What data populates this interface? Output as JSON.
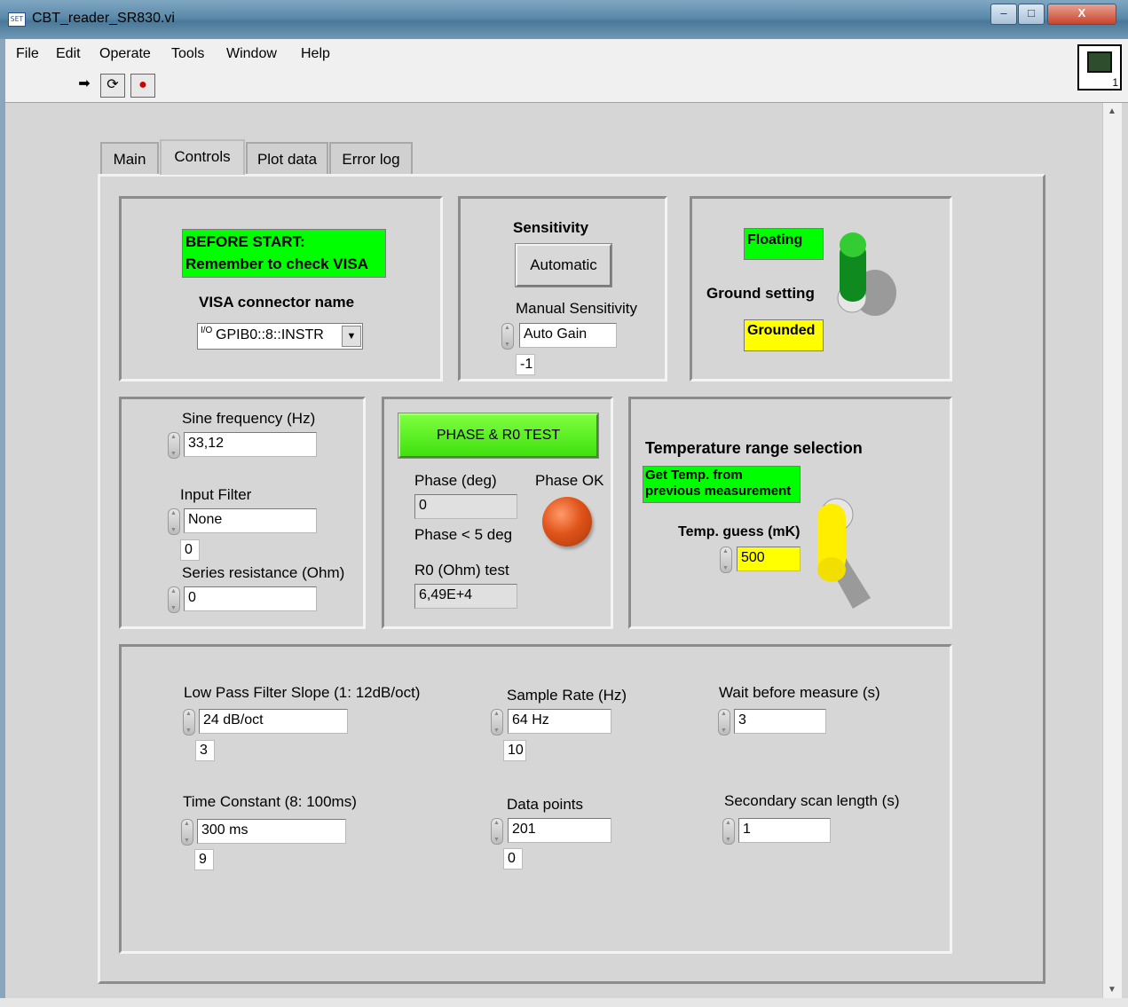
{
  "window": {
    "title": "CBT_reader_SR830.vi",
    "icon_text": "SET"
  },
  "window_buttons": {
    "min": "–",
    "max": "□",
    "close": "X"
  },
  "menu": [
    {
      "label": "File"
    },
    {
      "label": "Edit"
    },
    {
      "label": "Operate"
    },
    {
      "label": "Tools"
    },
    {
      "label": "Window"
    },
    {
      "label": "Help"
    }
  ],
  "toolbar": {
    "run": "➡",
    "run_continuously": "⟳",
    "abort": "●"
  },
  "vi_icon": {
    "number": "1"
  },
  "tabs": [
    {
      "label": "Main"
    },
    {
      "label": "Controls"
    },
    {
      "label": "Plot data"
    },
    {
      "label": "Error log"
    }
  ],
  "visa_box": {
    "warning": "BEFORE START:\nRemember to check VISA",
    "connector_label": "VISA connector name",
    "io_icon": "I/O",
    "connector_value": "GPIB0::8::INSTR",
    "dropdown_arrow": "▼"
  },
  "sensitivity_box": {
    "title": "Sensitivity",
    "auto_button": "Automatic",
    "manual_label": "Manual Sensitivity",
    "manual_value": "Auto Gain",
    "manual_index": "-1"
  },
  "ground_box": {
    "floating": "Floating",
    "label": "Ground setting",
    "grounded": "Grounded",
    "state": "Floating"
  },
  "signal_box": {
    "sine_label": "Sine frequency (Hz)",
    "sine_value": "33,12",
    "filter_label": "Input Filter",
    "filter_value": "None",
    "filter_index": "0",
    "series_label": "Series resistance (Ohm)",
    "series_value": "0"
  },
  "phase_box": {
    "test_button": "PHASE & R0 TEST",
    "phase_label": "Phase (deg)",
    "phase_value": "0",
    "phase_ok_label": "Phase OK",
    "phase_note": "Phase < 5 deg",
    "r0_label": "R0 (Ohm) test",
    "r0_value": "6,49E+4",
    "led_color": "#e0541a"
  },
  "temp_box": {
    "title": "Temperature range selection",
    "get_temp": "Get Temp. from\nprevious measurement",
    "guess_label": "Temp. guess (mK)",
    "guess_value": "500"
  },
  "lockin_box": {
    "lpf_label": "Low Pass Filter Slope (1: 12dB/oct)",
    "lpf_value": "24 dB/oct",
    "lpf_index": "3",
    "tc_label": "Time Constant (8: 100ms)",
    "tc_value": "300 ms",
    "tc_index": "9",
    "sr_label": "Sample Rate (Hz)",
    "sr_value": "64 Hz",
    "sr_index": "10",
    "dp_label": "Data points",
    "dp_value": "201",
    "dp_index": "0",
    "wait_label": "Wait before measure (s)",
    "wait_value": "3",
    "scan_label": "Secondary scan length (s)",
    "scan_value": "1"
  },
  "colors": {
    "green_led": "#00ff00",
    "yellow_led": "#ffff00",
    "panel_gray": "#d6d6d6",
    "toggle_green": "#0f8a1f",
    "toggle_yellow": "#ffee00"
  }
}
